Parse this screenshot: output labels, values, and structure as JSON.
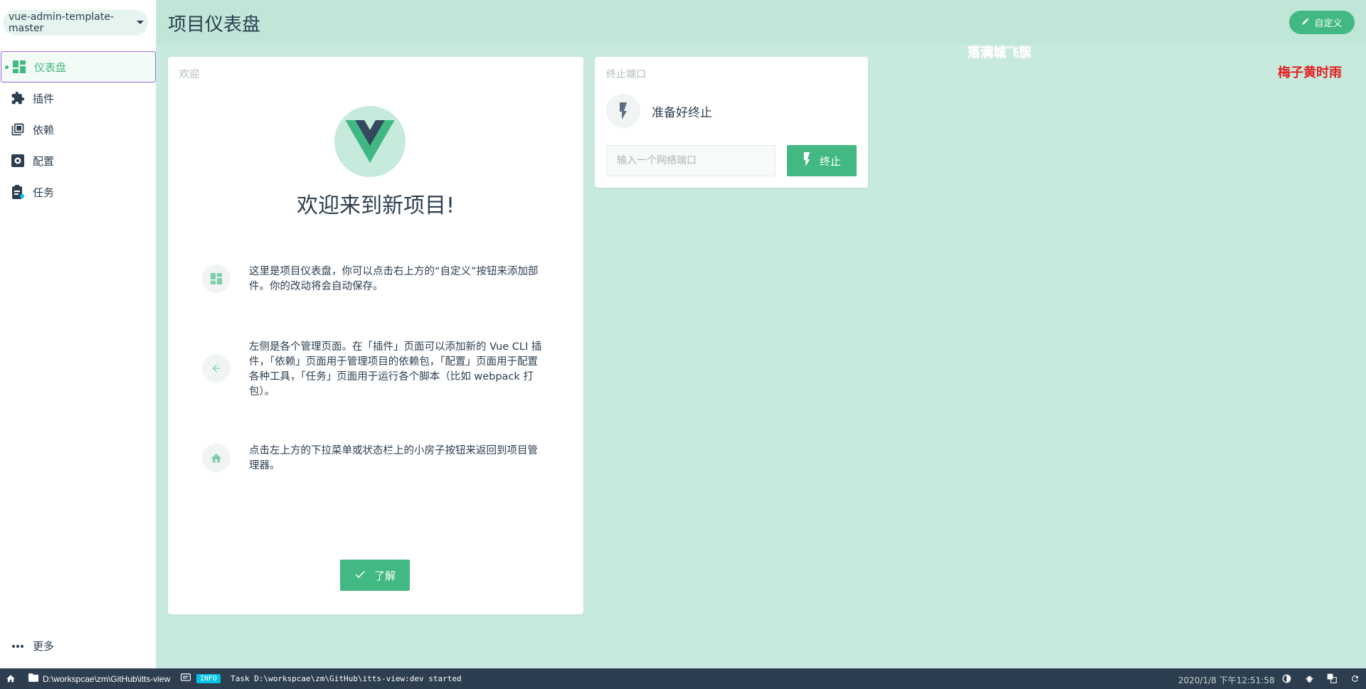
{
  "project": {
    "name": "vue-admin-template-master"
  },
  "sidebar": {
    "items": [
      {
        "label": "仪表盘",
        "icon": "dashboard-icon",
        "active": true
      },
      {
        "label": "插件",
        "icon": "puzzle-icon"
      },
      {
        "label": "依赖",
        "icon": "library-books-icon"
      },
      {
        "label": "配置",
        "icon": "settings-icon"
      },
      {
        "label": "任务",
        "icon": "assignment-icon"
      }
    ],
    "more_label": "更多"
  },
  "header": {
    "title": "项目仪表盘",
    "customize_label": "自定义"
  },
  "overlays": {
    "text1": "落满城飞絮",
    "text2": "梅子黄时雨"
  },
  "welcome": {
    "title": "欢迎",
    "heading": "欢迎来到新项目!",
    "tips": [
      "这里是项目仪表盘，你可以点击右上方的“自定义”按钮来添加部件。你的改动将会自动保存。",
      "左侧是各个管理页面。在「插件」页面可以添加新的 Vue CLI 插件，「依赖」页面用于管理项目的依赖包，「配置」页面用于配置各种工具，「任务」页面用于运行各个脚本（比如 webpack 打包）。",
      "点击左上方的下拉菜单或状态栏上的小房子按钮来返回到项目管理器。"
    ],
    "ok_label": "了解"
  },
  "kill_port": {
    "title": "终止端口",
    "status": "准备好终止",
    "input_placeholder": "输入一个网络端口",
    "button_label": "终止"
  },
  "statusbar": {
    "path": "D:\\workspcae\\zm\\GitHub\\itts-view",
    "log_level": "INFO",
    "log_message": "Task D:\\workspcae\\zm\\GitHub\\itts-view:dev started",
    "time": "2020/1/8 下午12:51:58"
  },
  "colors": {
    "accent": "#42b983",
    "dark": "#2c3e50",
    "background": "#c8e9dd",
    "info_badge": "#03c2e6",
    "overlay_red": "#e02020"
  }
}
